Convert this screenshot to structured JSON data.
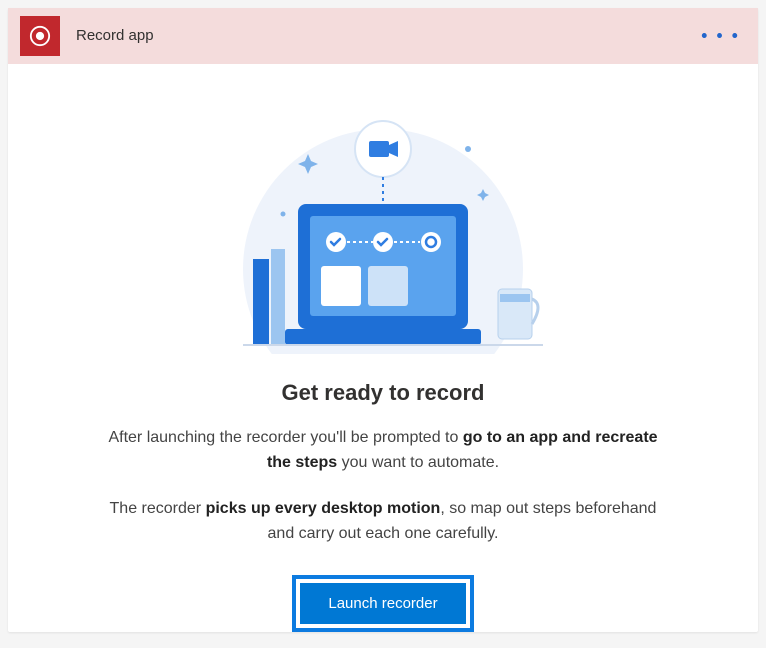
{
  "header": {
    "title": "Record app",
    "icon": "record-icon"
  },
  "illustration": {
    "camera_icon": "camera-icon"
  },
  "main": {
    "heading": "Get ready to record",
    "para1_before": "After launching the recorder you'll be prompted to ",
    "para1_bold": "go to an app and recreate the steps",
    "para1_after": " you want to automate.",
    "para2_before": "The recorder ",
    "para2_bold": "picks up every desktop motion",
    "para2_after": ", so map out steps beforehand and carry out each one carefully.",
    "launch_label": "Launch recorder"
  },
  "colors": {
    "header_bg": "#f4dcdc",
    "record_red": "#c1282d",
    "primary_blue": "#0078d4",
    "highlight_blue": "#0d7be0"
  }
}
